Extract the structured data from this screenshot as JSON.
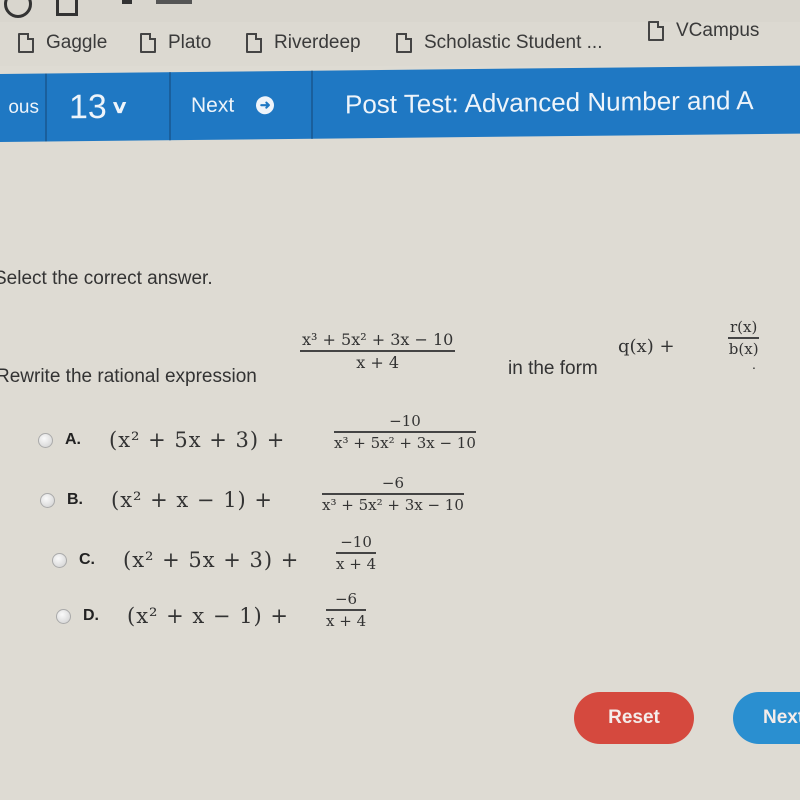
{
  "browser": {
    "bookmarks": [
      {
        "label": "Gaggle",
        "icon": "page-icon"
      },
      {
        "label": "Plato",
        "icon": "page-icon"
      },
      {
        "label": "Riverdeep",
        "icon": "page-icon"
      },
      {
        "label": "Scholastic Student ...",
        "icon": "page-icon"
      },
      {
        "label": "VCampus",
        "icon": "page-icon"
      }
    ]
  },
  "nav": {
    "previous_label": "ous",
    "question_number": "13",
    "question_dropdown_icon": "chevron-down-icon",
    "next_label": "Next",
    "next_icon": "arrow-right-circle-icon",
    "title": "Post Test: Advanced Number and A"
  },
  "question": {
    "instruction": "Select the correct answer.",
    "prompt_prefix": "Rewrite the rational expression",
    "expression": {
      "numerator": "x³ + 5x² + 3x − 10",
      "denominator": "x + 4"
    },
    "prompt_middle": "in the form",
    "form": {
      "whole": "q(x) +",
      "numerator": "r(x)",
      "denominator": "b(x)",
      "suffix": "."
    },
    "options": [
      {
        "letter": "A.",
        "quotient": "(x² + 5x + 3) +",
        "numerator": "−10",
        "denominator": "x³ + 5x² + 3x − 10"
      },
      {
        "letter": "B.",
        "quotient": "(x² + x − 1) +",
        "numerator": "−6",
        "denominator": "x³ + 5x² + 3x − 10"
      },
      {
        "letter": "C.",
        "quotient": "(x² + 5x + 3) +",
        "numerator": "−10",
        "denominator": "x + 4"
      },
      {
        "letter": "D.",
        "quotient": "(x² + x − 1) +",
        "numerator": "−6",
        "denominator": "x + 4"
      }
    ]
  },
  "actions": {
    "reset_label": "Reset",
    "next_label": "Next"
  },
  "colors": {
    "nav_blue": "#1f78c3",
    "reset_red": "#d5493e",
    "next_blue": "#2a8fd0"
  }
}
